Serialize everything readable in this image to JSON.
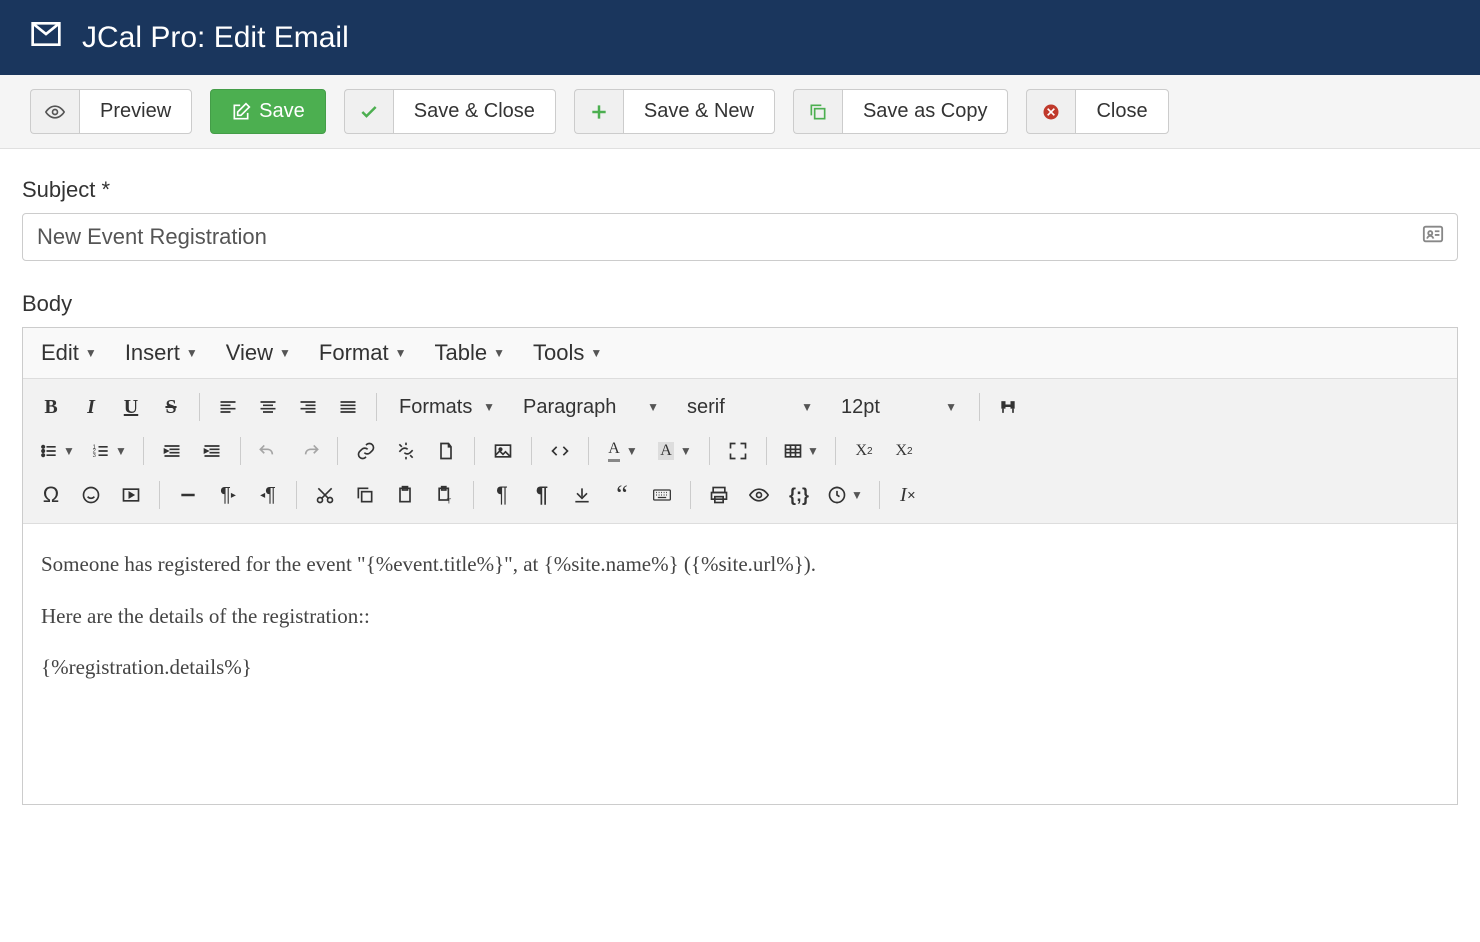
{
  "header": {
    "title": "JCal Pro: Edit Email"
  },
  "toolbar": {
    "preview": "Preview",
    "save": "Save",
    "save_close": "Save & Close",
    "save_new": "Save & New",
    "save_copy": "Save as Copy",
    "close": "Close"
  },
  "form": {
    "subject_label": "Subject *",
    "subject_value": "New Event Registration",
    "body_label": "Body"
  },
  "editor": {
    "menus": {
      "edit": "Edit",
      "insert": "Insert",
      "view": "View",
      "format": "Format",
      "table": "Table",
      "tools": "Tools"
    },
    "selects": {
      "formats": "Formats",
      "block": "Paragraph",
      "font": "serif",
      "size": "12pt"
    },
    "content": {
      "p1": "Someone has registered for the event \"{%event.title%}\", at {%site.name%} ({%site.url%}).",
      "p2": "Here are the details of the registration::",
      "p3": "{%registration.details%}"
    }
  }
}
